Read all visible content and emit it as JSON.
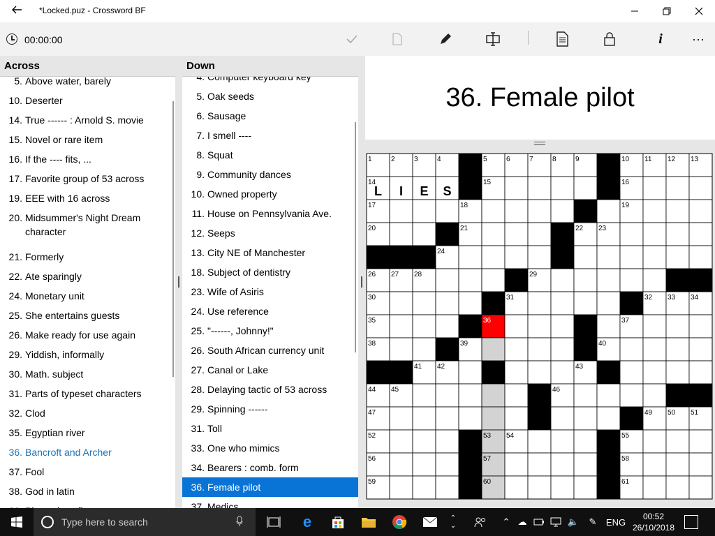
{
  "window": {
    "title": "*Locked.puz - Crossword BF",
    "back_icon": "arrow-left-icon",
    "minimize": "—",
    "maximize": "❐",
    "close": "✕"
  },
  "toolbar": {
    "timer": "00:00:00",
    "icons": [
      "clock-icon",
      "check-icon",
      "document-icon",
      "pencil-icon",
      "text-cursor-icon",
      "page-icon",
      "lock-icon",
      "info-icon",
      "more-icon"
    ]
  },
  "across": {
    "header": "Across",
    "clues": [
      {
        "num": "5.",
        "text": "Above water, barely"
      },
      {
        "num": "10.",
        "text": "Deserter"
      },
      {
        "num": "14.",
        "text": "True ------ : Arnold S. movie"
      },
      {
        "num": "15.",
        "text": "Novel or rare item"
      },
      {
        "num": "16.",
        "text": "If the ---- fits, ..."
      },
      {
        "num": "17.",
        "text": "Favorite group of 53 across"
      },
      {
        "num": "19.",
        "text": "EEE with 16 across"
      },
      {
        "num": "20.",
        "text": "Midsummer's Night Dream character"
      },
      {
        "num": "21.",
        "text": "Formerly"
      },
      {
        "num": "22.",
        "text": "Ate sparingly"
      },
      {
        "num": "24.",
        "text": "Monetary unit"
      },
      {
        "num": "25.",
        "text": "She entertains guests"
      },
      {
        "num": "26.",
        "text": "Make ready for use again"
      },
      {
        "num": "29.",
        "text": "Yiddish, informally"
      },
      {
        "num": "30.",
        "text": "Math. subject"
      },
      {
        "num": "31.",
        "text": "Parts of typeset characters"
      },
      {
        "num": "32.",
        "text": "Clod"
      },
      {
        "num": "35.",
        "text": "Egyptian river"
      },
      {
        "num": "36.",
        "text": "Bancroft and Archer"
      },
      {
        "num": "37.",
        "text": "Fool"
      },
      {
        "num": "38.",
        "text": "God in latin"
      },
      {
        "num": "39.",
        "text": "Pizza place fixtures"
      }
    ]
  },
  "down": {
    "header": "Down",
    "clues": [
      {
        "num": "4.",
        "text": "Computer keyboard key"
      },
      {
        "num": "5.",
        "text": "Oak seeds"
      },
      {
        "num": "6.",
        "text": "Sausage"
      },
      {
        "num": "7.",
        "text": "I smell ----"
      },
      {
        "num": "8.",
        "text": "Squat"
      },
      {
        "num": "9.",
        "text": "Community dances"
      },
      {
        "num": "10.",
        "text": "Owned property"
      },
      {
        "num": "11.",
        "text": "House on Pennsylvania Ave."
      },
      {
        "num": "12.",
        "text": "Seeps"
      },
      {
        "num": "13.",
        "text": "City NE of Manchester"
      },
      {
        "num": "18.",
        "text": "Subject of dentistry"
      },
      {
        "num": "23.",
        "text": "Wife of Asiris"
      },
      {
        "num": "24.",
        "text": "Use reference"
      },
      {
        "num": "25.",
        "text": "\"------, Johnny!\""
      },
      {
        "num": "26.",
        "text": "South African currency unit"
      },
      {
        "num": "27.",
        "text": "Canal or Lake"
      },
      {
        "num": "28.",
        "text": "Delaying tactic of 53 across"
      },
      {
        "num": "29.",
        "text": "Spinning ------"
      },
      {
        "num": "31.",
        "text": "Toll"
      },
      {
        "num": "33.",
        "text": "One who mimics"
      },
      {
        "num": "34.",
        "text": "Bearers : comb. form"
      },
      {
        "num": "36.",
        "text": "Female pilot"
      },
      {
        "num": "37.",
        "text": "Medics"
      }
    ]
  },
  "current_clue": "36. Female pilot",
  "puzzle": {
    "rows": [
      "....#.....#....",
      "....#.....#....",
      ".........#.....",
      "...#....#......",
      "###.....#......",
      "......#......##",
      ".....#.....#...",
      "....#....#.....",
      "...#.....#.....",
      "##...#....#....",
      ".......#.....##",
      ".......#...#...",
      "....#.....#....",
      "....#.....#....",
      "....#.....#...."
    ],
    "numbers": [
      [
        0,
        0,
        "1"
      ],
      [
        0,
        1,
        "2"
      ],
      [
        0,
        2,
        "3"
      ],
      [
        0,
        3,
        "4"
      ],
      [
        0,
        5,
        "5"
      ],
      [
        0,
        6,
        "6"
      ],
      [
        0,
        7,
        "7"
      ],
      [
        0,
        8,
        "8"
      ],
      [
        0,
        9,
        "9"
      ],
      [
        0,
        11,
        "10"
      ],
      [
        0,
        12,
        "11"
      ],
      [
        0,
        13,
        "12"
      ],
      [
        0,
        14,
        "13"
      ],
      [
        1,
        0,
        "14"
      ],
      [
        1,
        5,
        "15"
      ],
      [
        1,
        11,
        "16"
      ],
      [
        2,
        0,
        "17"
      ],
      [
        2,
        4,
        "18"
      ],
      [
        2,
        11,
        "19"
      ],
      [
        3,
        0,
        "20"
      ],
      [
        3,
        4,
        "21"
      ],
      [
        3,
        9,
        "22"
      ],
      [
        3,
        10,
        "23"
      ],
      [
        4,
        3,
        "24"
      ],
      [
        4,
        8,
        "25"
      ],
      [
        5,
        0,
        "26"
      ],
      [
        5,
        1,
        "27"
      ],
      [
        5,
        2,
        "28"
      ],
      [
        5,
        7,
        "29"
      ],
      [
        6,
        0,
        "30"
      ],
      [
        6,
        6,
        "31"
      ],
      [
        6,
        12,
        "32"
      ],
      [
        6,
        13,
        "33"
      ],
      [
        6,
        14,
        "34"
      ],
      [
        7,
        0,
        "35"
      ],
      [
        7,
        5,
        "36"
      ],
      [
        7,
        11,
        "37"
      ],
      [
        8,
        0,
        "38"
      ],
      [
        8,
        4,
        "39"
      ],
      [
        8,
        10,
        "40"
      ],
      [
        9,
        2,
        "41"
      ],
      [
        9,
        3,
        "42"
      ],
      [
        9,
        9,
        "43"
      ],
      [
        10,
        0,
        "44"
      ],
      [
        10,
        1,
        "45"
      ],
      [
        10,
        8,
        "46"
      ],
      [
        11,
        0,
        "47"
      ],
      [
        11,
        7,
        "48"
      ],
      [
        11,
        12,
        "49"
      ],
      [
        11,
        13,
        "50"
      ],
      [
        11,
        14,
        "51"
      ],
      [
        12,
        0,
        "52"
      ],
      [
        12,
        5,
        "53"
      ],
      [
        12,
        6,
        "54"
      ],
      [
        12,
        11,
        "55"
      ],
      [
        13,
        0,
        "56"
      ],
      [
        13,
        5,
        "57"
      ],
      [
        13,
        11,
        "58"
      ],
      [
        14,
        0,
        "59"
      ],
      [
        14,
        5,
        "60"
      ],
      [
        14,
        11,
        "61"
      ]
    ],
    "letters": [
      [
        1,
        0,
        "L"
      ],
      [
        1,
        1,
        "I"
      ],
      [
        1,
        2,
        "E"
      ],
      [
        1,
        3,
        "S"
      ]
    ],
    "selected_cell": [
      7,
      5
    ],
    "highlighted_cells": [
      [
        8,
        5
      ],
      [
        9,
        5
      ],
      [
        10,
        5
      ],
      [
        11,
        5
      ],
      [
        12,
        5
      ],
      [
        13,
        5
      ],
      [
        14,
        5
      ]
    ],
    "colors": {
      "block": "#000000",
      "selected": "#ff0000",
      "highlight": "#d3d3d3",
      "cell": "#ffffff"
    }
  },
  "taskbar": {
    "search_placeholder": "Type here to search",
    "language": "ENG",
    "time": "00:52",
    "date": "26/10/2018",
    "apps": [
      "task-view-icon",
      "edge-icon",
      "store-icon",
      "file-explorer-icon",
      "chrome-icon",
      "mail-icon"
    ]
  }
}
